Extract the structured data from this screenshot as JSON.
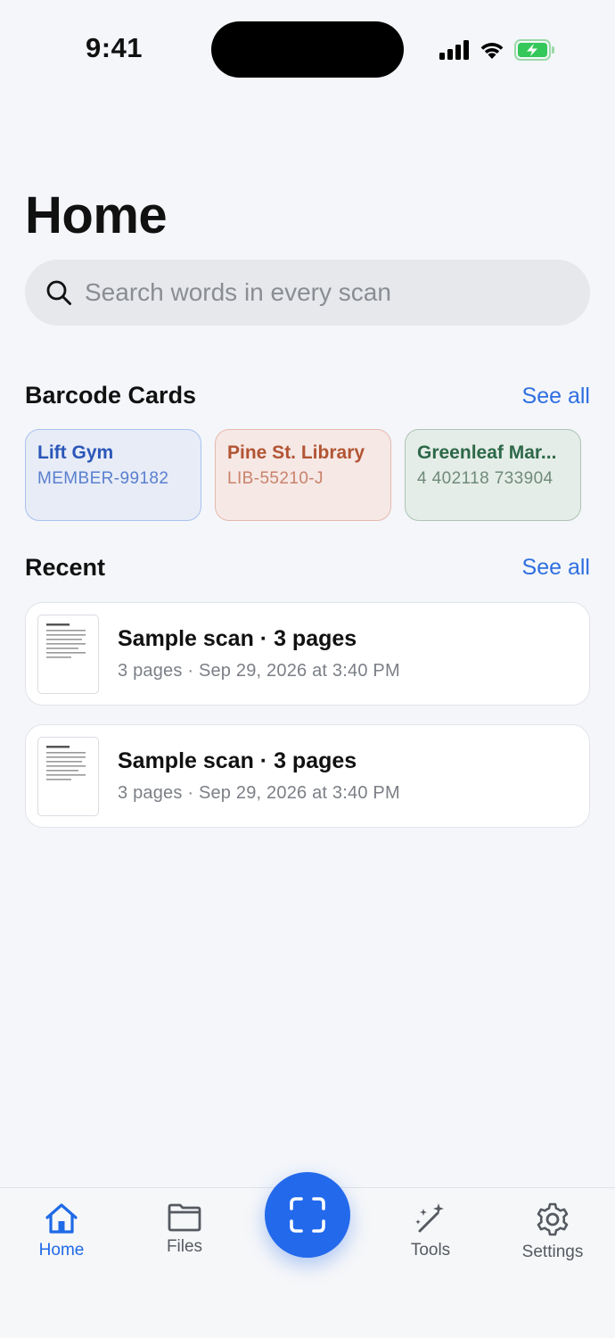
{
  "status_bar": {
    "time": "9:41"
  },
  "page": {
    "title": "Home"
  },
  "search": {
    "placeholder": "Search words in every scan"
  },
  "barcode_section": {
    "title": "Barcode Cards",
    "see_all": "See all",
    "cards": [
      {
        "name": "Lift Gym",
        "code": "MEMBER-99182",
        "bg": "#e7ecf7",
        "border": "#a9c2ee",
        "name_color": "#2a56b8",
        "code_color": "#5a7fce"
      },
      {
        "name": "Pine St. Library",
        "code": "LIB-55210-J",
        "bg": "#f6e8e5",
        "border": "#e6b9ae",
        "name_color": "#b25433",
        "code_color": "#c8826a"
      },
      {
        "name": "Greenleaf Mar...",
        "code": "4 402118 733904",
        "bg": "#e5ede8",
        "border": "#adc4b5",
        "name_color": "#2d6848",
        "code_color": "#6f8a7a"
      }
    ]
  },
  "recent_section": {
    "title": "Recent",
    "see_all": "See all",
    "items": [
      {
        "title": "Sample scan · 3 pages",
        "subtitle": "3 pages · Sep 29, 2026 at 3:40 PM"
      },
      {
        "title": "Sample scan · 3 pages",
        "subtitle": "3 pages · Sep 29, 2026 at 3:40 PM"
      }
    ]
  },
  "tab_bar": {
    "tabs": [
      {
        "label": "Home",
        "icon": "home-icon",
        "active": true
      },
      {
        "label": "Files",
        "icon": "folder-icon",
        "active": false
      },
      {
        "label": "Tools",
        "icon": "magic-wand-icon",
        "active": false
      },
      {
        "label": "Settings",
        "icon": "gear-icon",
        "active": false
      }
    ],
    "scan_button_icon": "scan-frame-icon"
  },
  "colors": {
    "accent": "#2369ec",
    "link": "#2f6fe0",
    "background": "#f4f6fa"
  }
}
